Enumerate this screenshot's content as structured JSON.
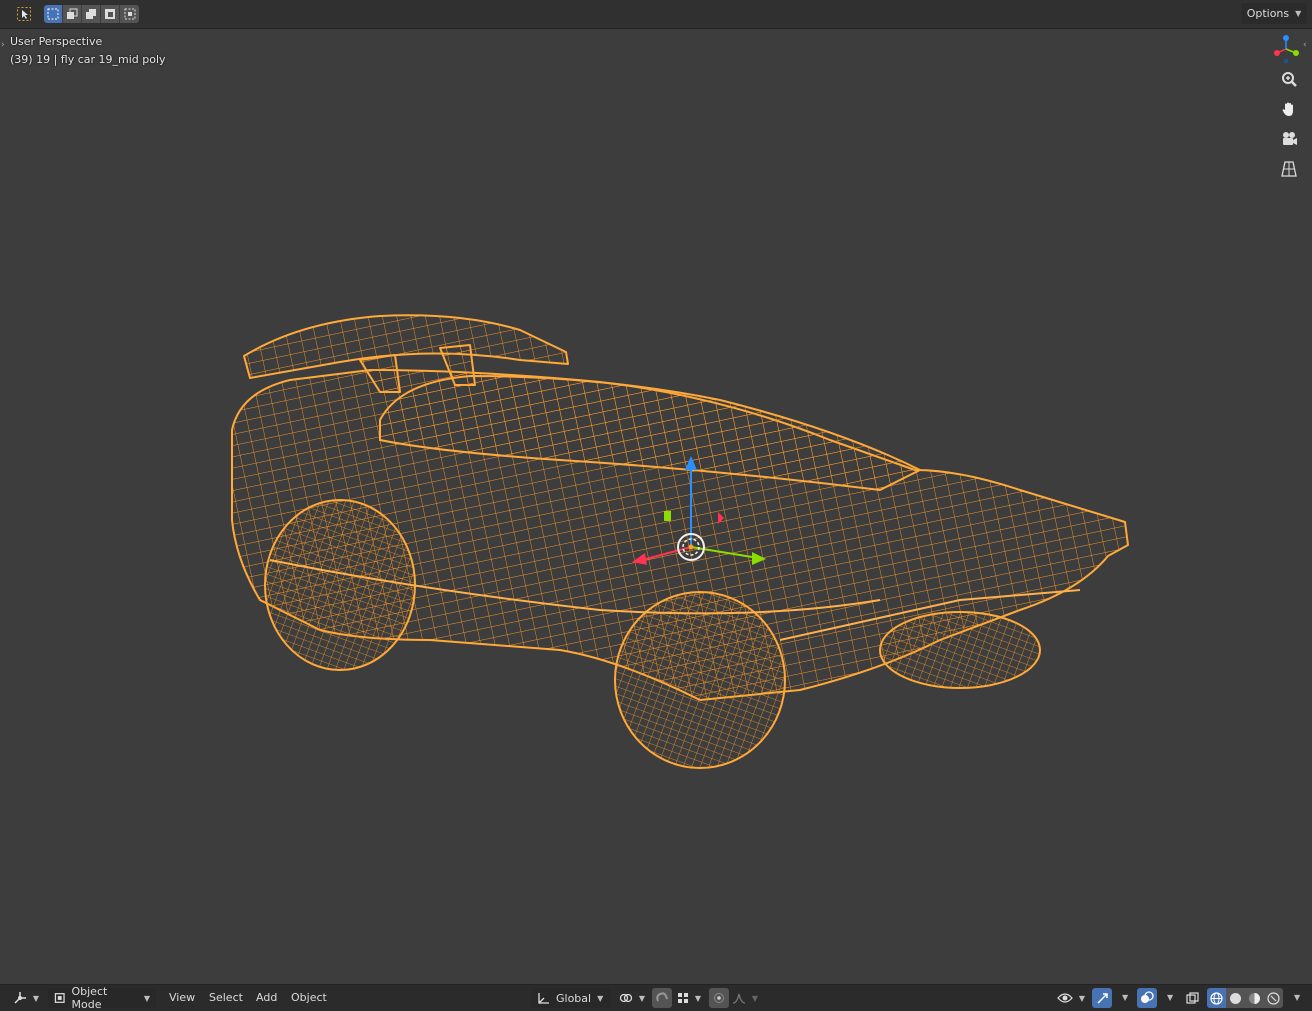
{
  "viewport": {
    "view_name": "User Perspective",
    "object_info": "(39) 19 | fly car 19_mid poly",
    "options_label": "Options"
  },
  "toolbar_top": {
    "mode_icons": [
      "select-box-icon",
      "set-new-icon",
      "extend-icon",
      "subtract-icon",
      "intersect-icon"
    ]
  },
  "header_bottom": {
    "mode_label": "Object Mode",
    "menus": [
      "View",
      "Select",
      "Add",
      "Object"
    ],
    "transform_orientation": "Global"
  },
  "colors": {
    "wire": "#ff9f2a",
    "background": "#3d3d3d",
    "accent": "#4772b3",
    "axis_x": "#ff3352",
    "axis_y": "#8bdc00",
    "axis_z": "#2890ff"
  }
}
